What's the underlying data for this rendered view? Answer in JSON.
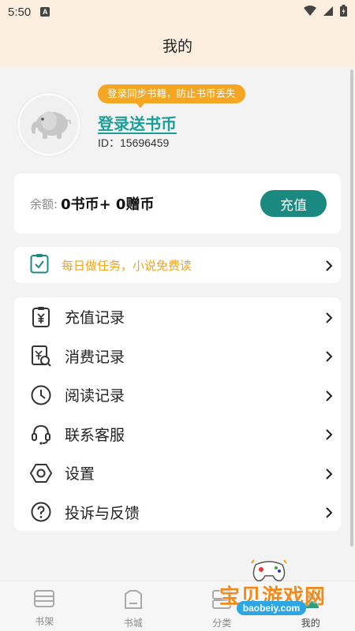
{
  "status_bar": {
    "time": "5:50",
    "notification_badge": "A"
  },
  "header": {
    "title": "我的"
  },
  "profile": {
    "tooltip": "登录同步书籍，防止书币丢失",
    "login_link": "登录送书币",
    "id_text": "ID：15696459",
    "avatar_icon": "elephant-avatar-icon"
  },
  "balance": {
    "label": "余额:",
    "value": "0书币+ 0赠币",
    "recharge_button": "充值"
  },
  "task": {
    "label": "每日做任务，小说免费读",
    "icon": "clipboard-check-icon"
  },
  "menu": [
    {
      "label": "充值记录",
      "icon": "recharge-record-icon"
    },
    {
      "label": "消费记录",
      "icon": "consume-record-icon"
    },
    {
      "label": "阅读记录",
      "icon": "clock-icon"
    },
    {
      "label": "联系客服",
      "icon": "headset-icon"
    },
    {
      "label": "设置",
      "icon": "settings-hexagon-icon"
    },
    {
      "label": "投诉与反馈",
      "icon": "question-icon"
    }
  ],
  "tabs": [
    {
      "label": "书架",
      "icon": "bookshelf-icon"
    },
    {
      "label": "书城",
      "icon": "bookstore-icon"
    },
    {
      "label": "分类",
      "icon": "category-icon"
    },
    {
      "label": "我的",
      "icon": "profile-icon"
    }
  ],
  "watermark": {
    "text": "宝贝游戏网",
    "url": "baobeiy.com"
  },
  "colors": {
    "accent": "#1a8a80",
    "link": "#1a9e96",
    "orange": "#f5a623",
    "header_bg": "#fcefe0"
  }
}
